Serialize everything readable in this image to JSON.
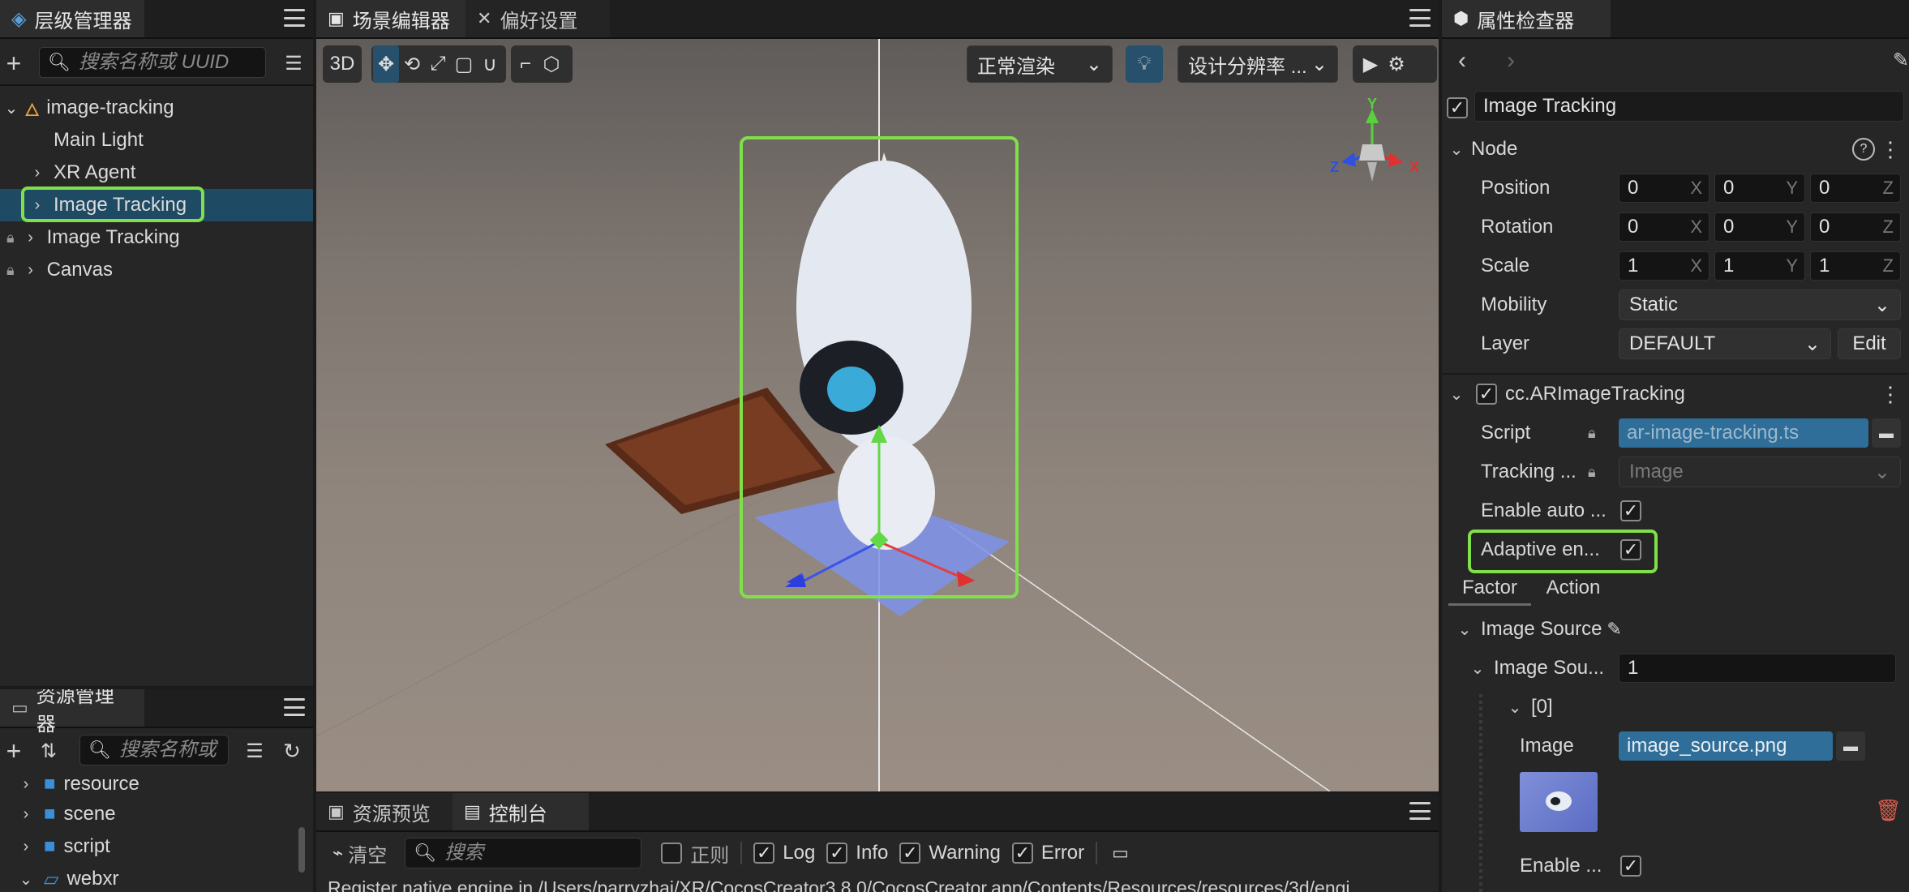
{
  "hierarchy": {
    "title": "层级管理器",
    "search_placeholder": "搜索名称或 UUID",
    "root": "image-tracking",
    "nodes": [
      "Main Light",
      "XR Agent",
      "Image Tracking",
      "Image Tracking",
      "Canvas"
    ]
  },
  "assets": {
    "title": "资源管理器",
    "search_placeholder": "搜索名称或",
    "folders": [
      "resource",
      "scene",
      "script",
      "webxr"
    ]
  },
  "scene": {
    "tabs": [
      "场景编辑器",
      "偏好设置"
    ],
    "mode_label": "3D",
    "render_mode": "正常渲染",
    "resolution": "设计分辨率 ...",
    "gizmo_axes": {
      "x": "X",
      "y": "Y",
      "z": "Z"
    }
  },
  "console": {
    "tabs": [
      "资源预览",
      "控制台"
    ],
    "clear_label": "清空",
    "search_placeholder": "搜索",
    "filters": [
      {
        "label": "正则",
        "checked": false
      },
      {
        "label": "Log",
        "checked": true
      },
      {
        "label": "Info",
        "checked": true
      },
      {
        "label": "Warning",
        "checked": true
      },
      {
        "label": "Error",
        "checked": true
      }
    ],
    "log_line": "Register native engine in /Users/parryzhai/XR/CocosCreator3.8.0/CocosCreator.app/Contents/Resources/resources/3d/engi"
  },
  "inspector": {
    "title": "属性检查器",
    "node_name": "Image Tracking",
    "node_section": "Node",
    "position": {
      "label": "Position",
      "x": "0",
      "y": "0",
      "z": "0"
    },
    "rotation": {
      "label": "Rotation",
      "x": "0",
      "y": "0",
      "z": "0"
    },
    "scale": {
      "label": "Scale",
      "x": "1",
      "y": "1",
      "z": "1"
    },
    "mobility": {
      "label": "Mobility",
      "value": "Static"
    },
    "layer": {
      "label": "Layer",
      "value": "DEFAULT",
      "edit": "Edit"
    },
    "component": "cc.ARImageTracking",
    "script": {
      "label": "Script",
      "value": "ar-image-tracking.ts"
    },
    "tracking": {
      "label": "Tracking ...",
      "value": "Image"
    },
    "enable_auto": "Enable auto ...",
    "adaptive": "Adaptive en...",
    "subtabs": [
      "Factor",
      "Action"
    ],
    "image_source": "Image Source",
    "image_sou": {
      "label": "Image Sou...",
      "value": "1"
    },
    "index": "[0]",
    "image": {
      "label": "Image",
      "value": "image_source.png"
    },
    "enable": "Enable ..."
  },
  "colors": {
    "accent": "#7fe04a",
    "selection": "#1f4a63",
    "asset_blue": "#2f6e99"
  }
}
